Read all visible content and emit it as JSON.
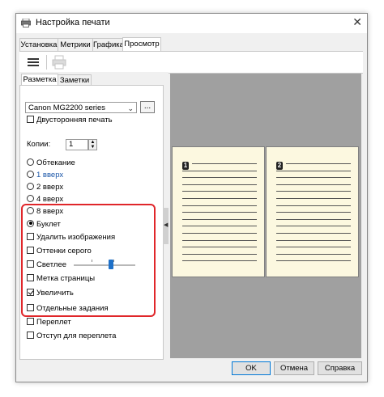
{
  "window": {
    "title": "Настройка печати"
  },
  "tabs": [
    {
      "label": "Установка"
    },
    {
      "label": "Метрики"
    },
    {
      "label": "Графика"
    },
    {
      "label": "Просмотр",
      "active": true
    }
  ],
  "subtabs": [
    {
      "label": "Разметка",
      "active": true
    },
    {
      "label": "Заметки"
    }
  ],
  "printer": {
    "selected": "Canon MG2200 series",
    "more_label": "..."
  },
  "duplex": {
    "label": "Двусторонняя печать",
    "checked": false
  },
  "copies": {
    "label": "Копии:",
    "value": "1"
  },
  "layout_options": [
    {
      "label": "Обтекание",
      "checked": false,
      "blue": false
    },
    {
      "label": "1 вверх",
      "checked": false,
      "blue": true
    },
    {
      "label": "2 вверх",
      "checked": false,
      "blue": false
    },
    {
      "label": "4 вверх",
      "checked": false,
      "blue": false
    },
    {
      "label": "8 вверх",
      "checked": false,
      "blue": false
    },
    {
      "label": "Буклет",
      "checked": true,
      "blue": false
    }
  ],
  "options": [
    {
      "label": "Удалить изображения",
      "checked": false
    },
    {
      "label": "Оттенки серого",
      "checked": false
    },
    {
      "label": "Светлее",
      "checked": false
    },
    {
      "label": "Метка страницы",
      "checked": false
    },
    {
      "label": "Увеличить",
      "checked": true
    },
    {
      "label": "Отдельные задания",
      "checked": false
    },
    {
      "label": "Переплет",
      "checked": false
    },
    {
      "label": "Отступ для переплета",
      "checked": false
    }
  ],
  "enlarge_slider": {
    "value_fraction": 0.6
  },
  "preview": {
    "pages": [
      {
        "number": "1"
      },
      {
        "number": "2"
      }
    ]
  },
  "footer": {
    "ok_label": "OK",
    "cancel_label": "Отмена",
    "help_label": "Справка"
  }
}
